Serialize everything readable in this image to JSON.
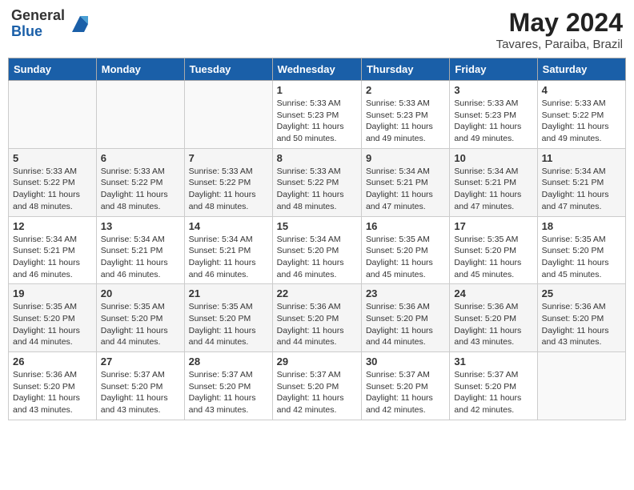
{
  "header": {
    "logo_general": "General",
    "logo_blue": "Blue",
    "title": "May 2024",
    "location": "Tavares, Paraiba, Brazil"
  },
  "weekdays": [
    "Sunday",
    "Monday",
    "Tuesday",
    "Wednesday",
    "Thursday",
    "Friday",
    "Saturday"
  ],
  "weeks": [
    [
      {
        "day": "",
        "info": ""
      },
      {
        "day": "",
        "info": ""
      },
      {
        "day": "",
        "info": ""
      },
      {
        "day": "1",
        "info": "Sunrise: 5:33 AM\nSunset: 5:23 PM\nDaylight: 11 hours and 50 minutes."
      },
      {
        "day": "2",
        "info": "Sunrise: 5:33 AM\nSunset: 5:23 PM\nDaylight: 11 hours and 49 minutes."
      },
      {
        "day": "3",
        "info": "Sunrise: 5:33 AM\nSunset: 5:23 PM\nDaylight: 11 hours and 49 minutes."
      },
      {
        "day": "4",
        "info": "Sunrise: 5:33 AM\nSunset: 5:22 PM\nDaylight: 11 hours and 49 minutes."
      }
    ],
    [
      {
        "day": "5",
        "info": "Sunrise: 5:33 AM\nSunset: 5:22 PM\nDaylight: 11 hours and 48 minutes."
      },
      {
        "day": "6",
        "info": "Sunrise: 5:33 AM\nSunset: 5:22 PM\nDaylight: 11 hours and 48 minutes."
      },
      {
        "day": "7",
        "info": "Sunrise: 5:33 AM\nSunset: 5:22 PM\nDaylight: 11 hours and 48 minutes."
      },
      {
        "day": "8",
        "info": "Sunrise: 5:33 AM\nSunset: 5:22 PM\nDaylight: 11 hours and 48 minutes."
      },
      {
        "day": "9",
        "info": "Sunrise: 5:34 AM\nSunset: 5:21 PM\nDaylight: 11 hours and 47 minutes."
      },
      {
        "day": "10",
        "info": "Sunrise: 5:34 AM\nSunset: 5:21 PM\nDaylight: 11 hours and 47 minutes."
      },
      {
        "day": "11",
        "info": "Sunrise: 5:34 AM\nSunset: 5:21 PM\nDaylight: 11 hours and 47 minutes."
      }
    ],
    [
      {
        "day": "12",
        "info": "Sunrise: 5:34 AM\nSunset: 5:21 PM\nDaylight: 11 hours and 46 minutes."
      },
      {
        "day": "13",
        "info": "Sunrise: 5:34 AM\nSunset: 5:21 PM\nDaylight: 11 hours and 46 minutes."
      },
      {
        "day": "14",
        "info": "Sunrise: 5:34 AM\nSunset: 5:21 PM\nDaylight: 11 hours and 46 minutes."
      },
      {
        "day": "15",
        "info": "Sunrise: 5:34 AM\nSunset: 5:20 PM\nDaylight: 11 hours and 46 minutes."
      },
      {
        "day": "16",
        "info": "Sunrise: 5:35 AM\nSunset: 5:20 PM\nDaylight: 11 hours and 45 minutes."
      },
      {
        "day": "17",
        "info": "Sunrise: 5:35 AM\nSunset: 5:20 PM\nDaylight: 11 hours and 45 minutes."
      },
      {
        "day": "18",
        "info": "Sunrise: 5:35 AM\nSunset: 5:20 PM\nDaylight: 11 hours and 45 minutes."
      }
    ],
    [
      {
        "day": "19",
        "info": "Sunrise: 5:35 AM\nSunset: 5:20 PM\nDaylight: 11 hours and 44 minutes."
      },
      {
        "day": "20",
        "info": "Sunrise: 5:35 AM\nSunset: 5:20 PM\nDaylight: 11 hours and 44 minutes."
      },
      {
        "day": "21",
        "info": "Sunrise: 5:35 AM\nSunset: 5:20 PM\nDaylight: 11 hours and 44 minutes."
      },
      {
        "day": "22",
        "info": "Sunrise: 5:36 AM\nSunset: 5:20 PM\nDaylight: 11 hours and 44 minutes."
      },
      {
        "day": "23",
        "info": "Sunrise: 5:36 AM\nSunset: 5:20 PM\nDaylight: 11 hours and 44 minutes."
      },
      {
        "day": "24",
        "info": "Sunrise: 5:36 AM\nSunset: 5:20 PM\nDaylight: 11 hours and 43 minutes."
      },
      {
        "day": "25",
        "info": "Sunrise: 5:36 AM\nSunset: 5:20 PM\nDaylight: 11 hours and 43 minutes."
      }
    ],
    [
      {
        "day": "26",
        "info": "Sunrise: 5:36 AM\nSunset: 5:20 PM\nDaylight: 11 hours and 43 minutes."
      },
      {
        "day": "27",
        "info": "Sunrise: 5:37 AM\nSunset: 5:20 PM\nDaylight: 11 hours and 43 minutes."
      },
      {
        "day": "28",
        "info": "Sunrise: 5:37 AM\nSunset: 5:20 PM\nDaylight: 11 hours and 43 minutes."
      },
      {
        "day": "29",
        "info": "Sunrise: 5:37 AM\nSunset: 5:20 PM\nDaylight: 11 hours and 42 minutes."
      },
      {
        "day": "30",
        "info": "Sunrise: 5:37 AM\nSunset: 5:20 PM\nDaylight: 11 hours and 42 minutes."
      },
      {
        "day": "31",
        "info": "Sunrise: 5:37 AM\nSunset: 5:20 PM\nDaylight: 11 hours and 42 minutes."
      },
      {
        "day": "",
        "info": ""
      }
    ]
  ]
}
